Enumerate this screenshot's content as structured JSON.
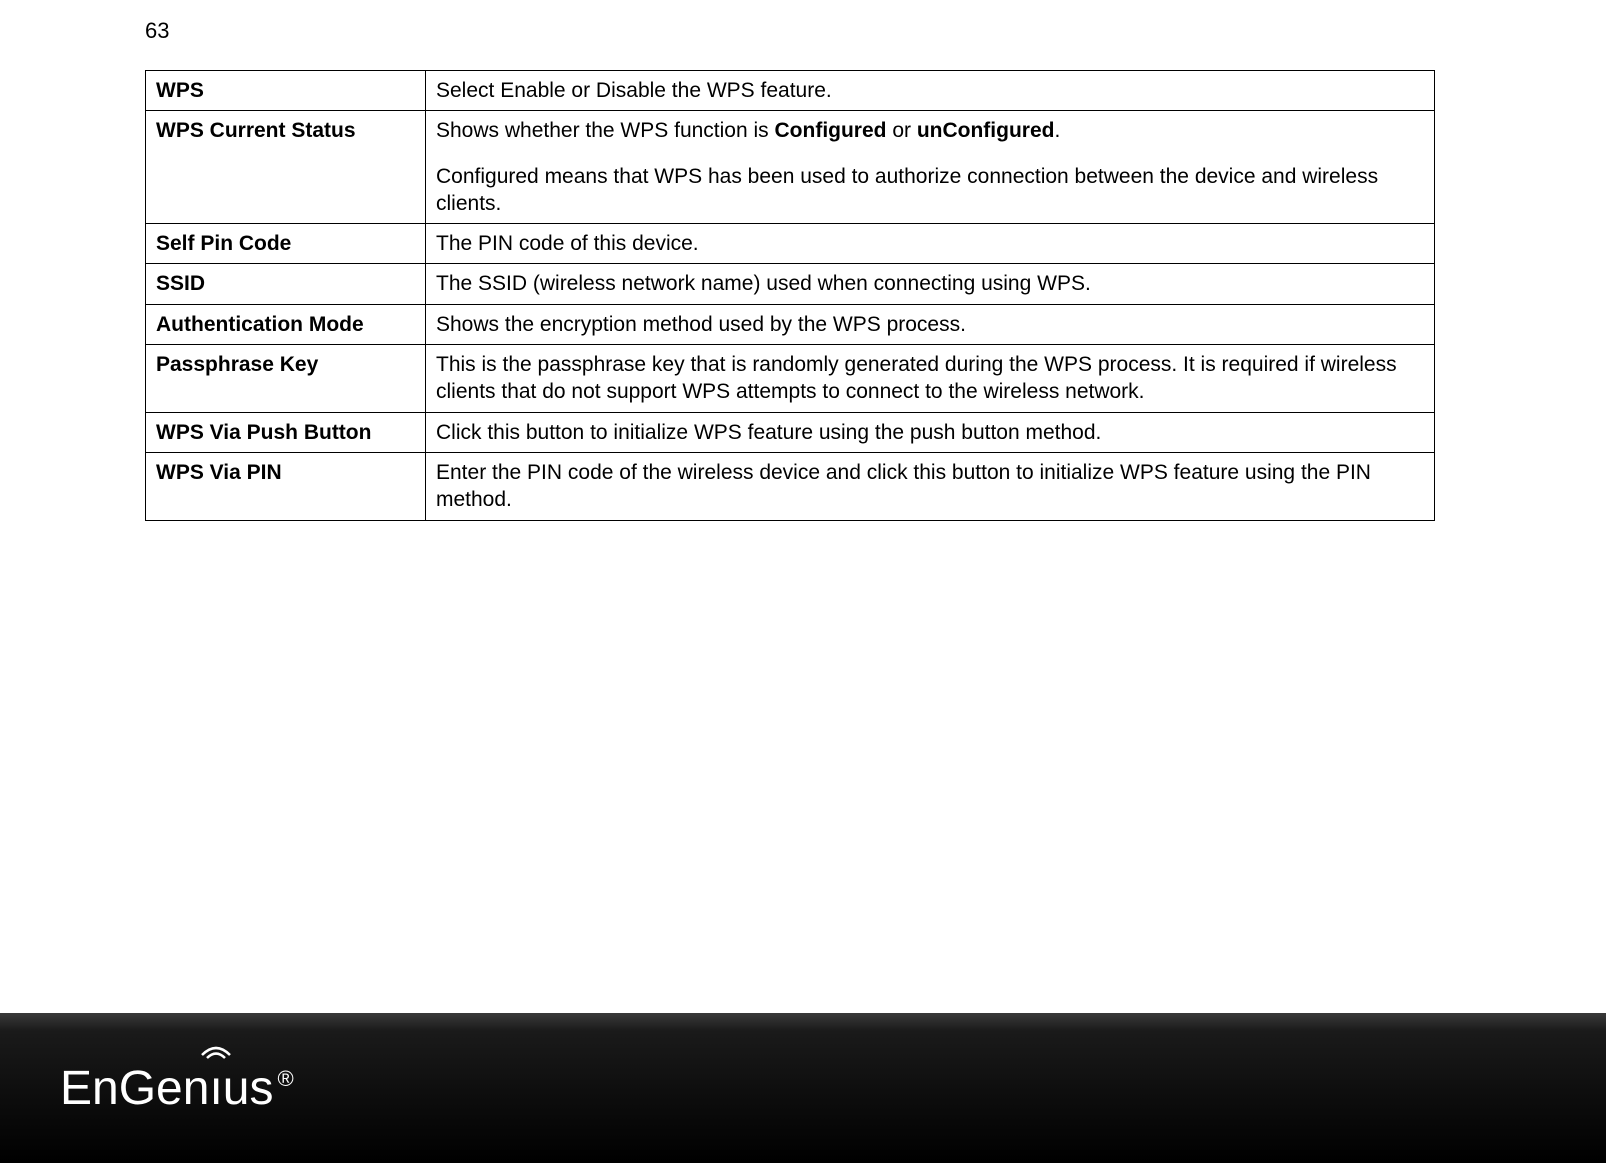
{
  "page_number": "63",
  "table": {
    "rows": [
      {
        "label": "WPS",
        "desc_plain": "Select Enable or Disable the WPS feature."
      },
      {
        "label": "WPS Current Status",
        "desc_pre": "Shows whether the WPS function is ",
        "bold1": "Configured",
        "desc_mid": " or ",
        "bold2": "unConfigured",
        "desc_post1": ".",
        "desc_para2": "Configured means that WPS has been used to authorize connection between the device and wireless clients."
      },
      {
        "label": "Self Pin Code",
        "desc_plain": "The PIN code of this device."
      },
      {
        "label": "SSID",
        "desc_plain": "The SSID (wireless network name) used when connecting using WPS."
      },
      {
        "label": "Authentication Mode",
        "desc_plain": "Shows the encryption method used by the WPS process."
      },
      {
        "label": "Passphrase Key",
        "desc_plain": "This is the passphrase key that is randomly generated during the WPS process. It is required if wireless clients that do not support WPS attempts to connect to the wireless network."
      },
      {
        "label": "WPS Via Push Button",
        "desc_plain": "Click this button to initialize WPS feature using the push button method."
      },
      {
        "label": "WPS Via PIN",
        "desc_plain": "Enter the PIN code of the wireless device and click this button to initialize WPS feature using the PIN method."
      }
    ]
  },
  "logo": {
    "part1": "EnGen",
    "part2": "ı",
    "part3": "us",
    "reg": "®"
  }
}
